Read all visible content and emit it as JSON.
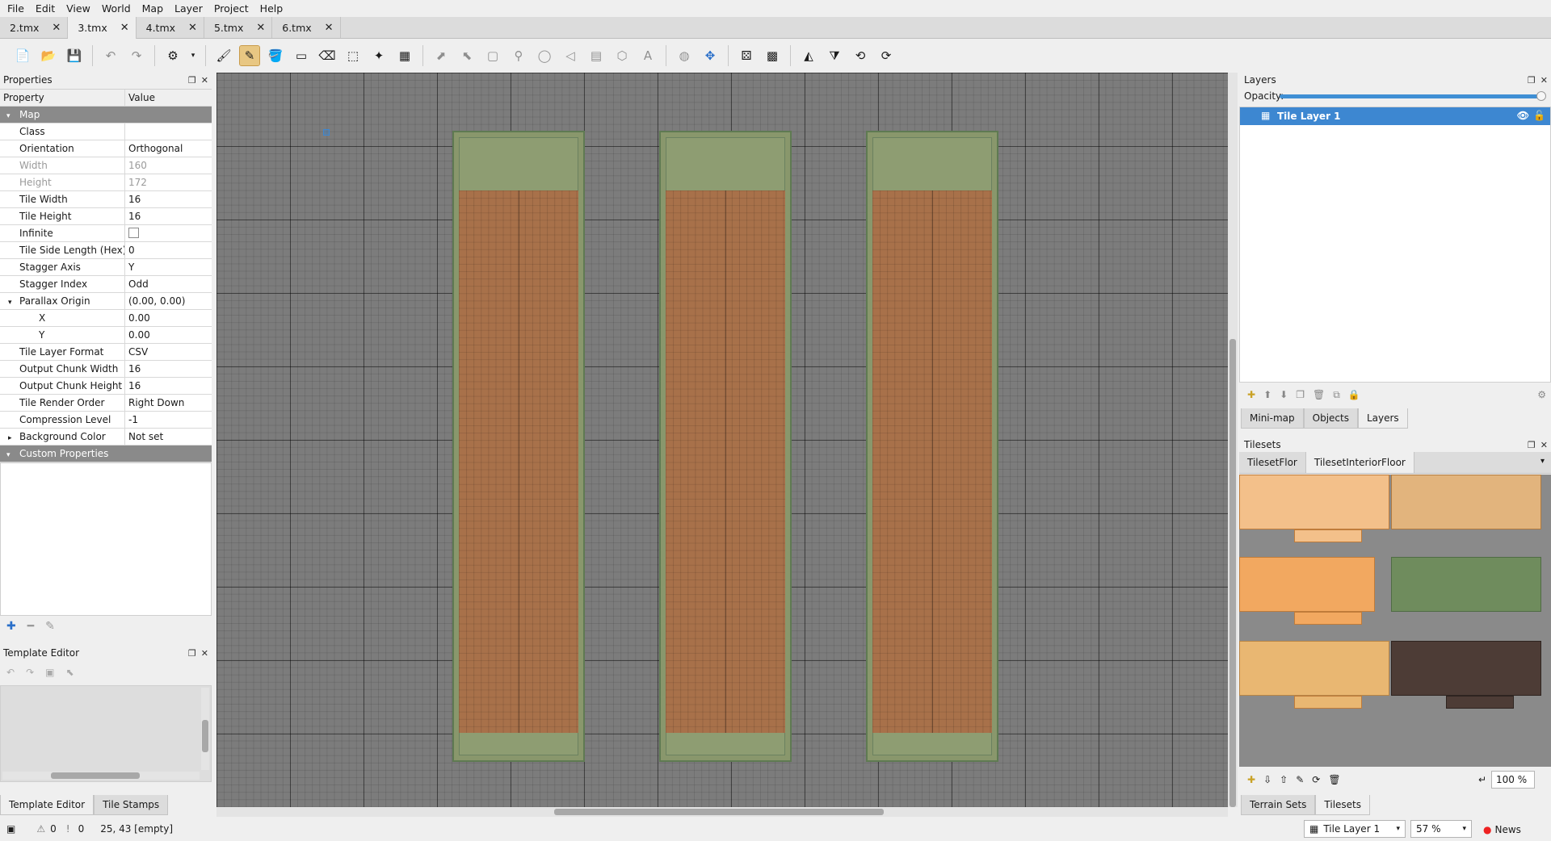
{
  "menu": [
    "File",
    "Edit",
    "View",
    "World",
    "Map",
    "Layer",
    "Project",
    "Help"
  ],
  "tabs": [
    {
      "label": "2.tmx",
      "active": false
    },
    {
      "label": "3.tmx",
      "active": true
    },
    {
      "label": "4.tmx",
      "active": false
    },
    {
      "label": "5.tmx",
      "active": false
    },
    {
      "label": "6.tmx",
      "active": false
    }
  ],
  "tab_close_glyph": "✕",
  "properties": {
    "title": "Properties",
    "col_property": "Property",
    "col_value": "Value",
    "rows": [
      {
        "k": "Map",
        "v": "",
        "type": "group"
      },
      {
        "k": "Class",
        "v": ""
      },
      {
        "k": "Orientation",
        "v": "Orthogonal"
      },
      {
        "k": "Width",
        "v": "160",
        "type": "disabled"
      },
      {
        "k": "Height",
        "v": "172",
        "type": "disabled"
      },
      {
        "k": "Tile Width",
        "v": "16"
      },
      {
        "k": "Tile Height",
        "v": "16"
      },
      {
        "k": "Infinite",
        "v": "",
        "type": "checkbox"
      },
      {
        "k": "Tile Side Length (Hex)",
        "v": "0"
      },
      {
        "k": "Stagger Axis",
        "v": "Y"
      },
      {
        "k": "Stagger Index",
        "v": "Odd"
      },
      {
        "k": "Parallax Origin",
        "v": "(0.00, 0.00)",
        "type": "expanded"
      },
      {
        "k": "X",
        "v": "0.00",
        "type": "sub"
      },
      {
        "k": "Y",
        "v": "0.00",
        "type": "sub"
      },
      {
        "k": "Tile Layer Format",
        "v": "CSV"
      },
      {
        "k": "Output Chunk Width",
        "v": "16"
      },
      {
        "k": "Output Chunk Height",
        "v": "16"
      },
      {
        "k": "Tile Render Order",
        "v": "Right Down"
      },
      {
        "k": "Compression Level",
        "v": "-1"
      },
      {
        "k": "Background Color",
        "v": "Not set",
        "type": "collapsed"
      },
      {
        "k": "Custom Properties",
        "v": "",
        "type": "group"
      }
    ]
  },
  "template_editor": {
    "title": "Template Editor"
  },
  "left_bottom_tabs": [
    "Template Editor",
    "Tile Stamps"
  ],
  "layers": {
    "title": "Layers",
    "opacity_label": "Opacity:",
    "opacity": 1.0,
    "items": [
      {
        "name": "Tile Layer 1",
        "selected": true
      }
    ]
  },
  "right_mid_tabs": [
    "Mini-map",
    "Objects",
    "Layers"
  ],
  "tilesets": {
    "title": "Tilesets",
    "tabs": [
      "TilesetFlor",
      "TilesetInteriorFloor"
    ],
    "zoom": "100 %"
  },
  "right_bottom_tabs": [
    "Terrain Sets",
    "Tilesets"
  ],
  "status": {
    "warnings": "0",
    "errors": "0",
    "position": "25, 43 [empty]",
    "layer_combo": "Tile Layer 1",
    "zoom": "57 %",
    "news": "News"
  },
  "colors": {
    "selection": "#3d87d1",
    "canvas": "#7c7c7c",
    "grass": "#89976c",
    "dirt": "#a8714a"
  }
}
